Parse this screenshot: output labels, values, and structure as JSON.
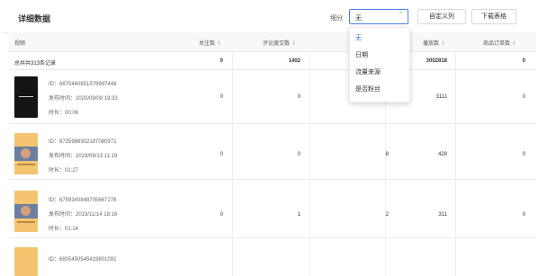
{
  "header": {
    "title": "详细数据",
    "split_label": "细分",
    "select_value": "无",
    "custom_columns": "自定义列",
    "download_table": "下载表格"
  },
  "dropdown": {
    "options": [
      "无",
      "日期",
      "流量来源",
      "是否粉丝"
    ],
    "selected": "无"
  },
  "table": {
    "columns": [
      "视频",
      "关注数",
      "评论度交数",
      "播放数",
      "商品订单数"
    ],
    "sort_icon": "⇕",
    "summary": {
      "label": "总共共313条记录",
      "follows": "0",
      "comments": "1402",
      "plays": "3002818",
      "orders": "0"
    },
    "rows": [
      {
        "id_line": "ID：6870440851579997448",
        "date_line": "发布时间：2020/09/09 19:33",
        "duration_line": "时长：00:06",
        "follows": "0",
        "comments": "0",
        "mid": "",
        "plays": "3111",
        "orders": "0",
        "thumb": "dark"
      },
      {
        "id_line": "ID：6735986302187080971",
        "date_line": "发布时间：2019/09/13 11:19",
        "duration_line": "时长：01:27",
        "follows": "0",
        "comments": "0",
        "mid": "8",
        "plays": "428",
        "orders": "0",
        "thumb": "warm"
      },
      {
        "id_line": "ID：6759340848705667176",
        "date_line": "发布时间：2019/11/14 18:16",
        "duration_line": "时长：01:14",
        "follows": "0",
        "comments": "1",
        "mid": "2",
        "plays": "311",
        "orders": "0",
        "thumb": "warm"
      },
      {
        "id_line": "ID：6805450545419801091",
        "thumb": "warm"
      }
    ]
  },
  "colors": {
    "accent": "#4a82e8",
    "link_active": "#2f6bd8"
  }
}
